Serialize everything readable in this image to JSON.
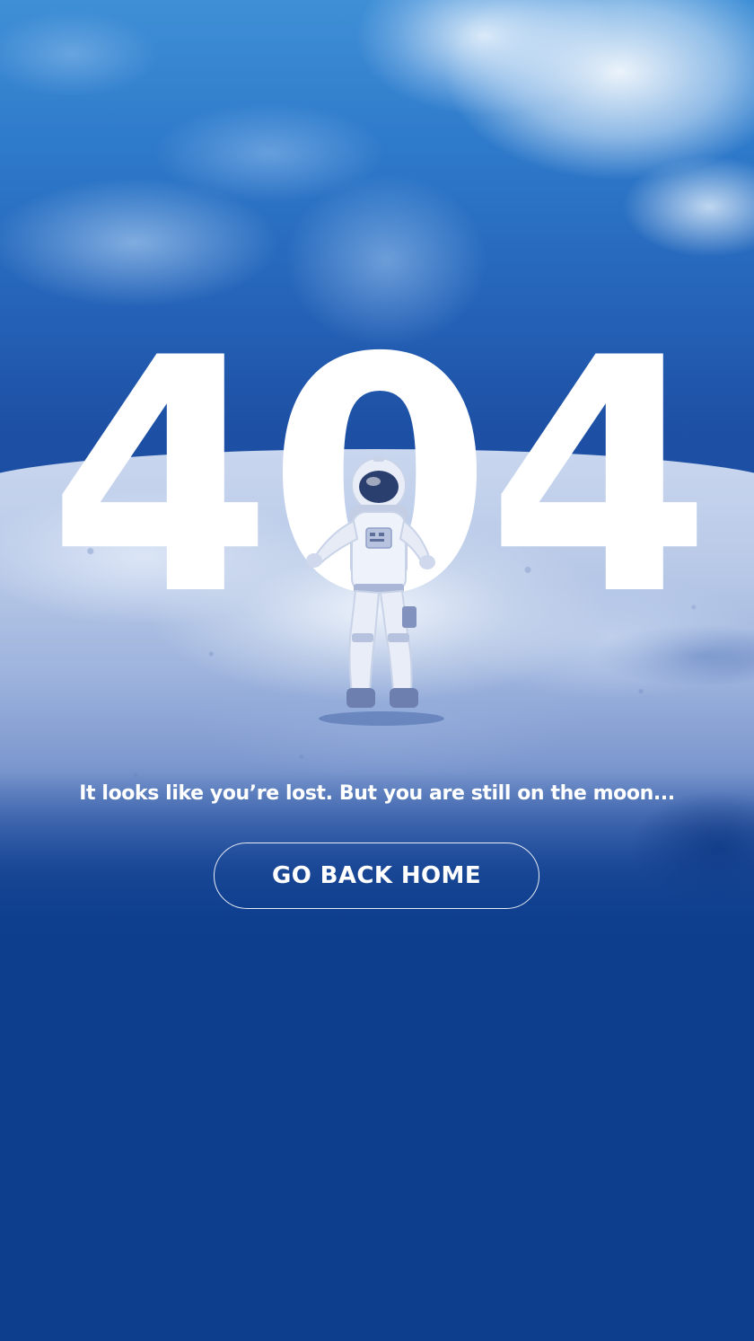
{
  "error": {
    "code": "404",
    "message": "It looks like you’re lost. But you are still on the moon..."
  },
  "actions": {
    "home_label": "GO BACK HOME"
  },
  "theme": {
    "background": "#0d3d8d",
    "text": "#ffffff",
    "button_border": "#ffffff"
  },
  "scene": {
    "illustration": "astronaut-on-moon-with-earth",
    "icons": [
      "astronaut-icon"
    ]
  }
}
